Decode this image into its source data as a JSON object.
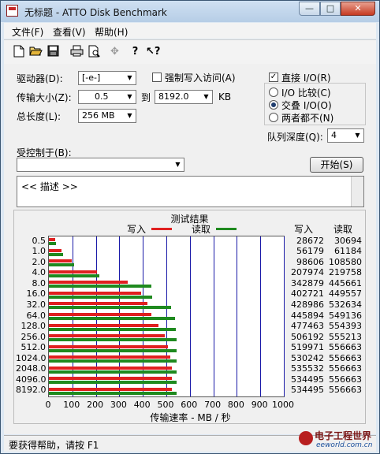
{
  "window": {
    "title": "无标题 - ATTO Disk Benchmark",
    "min": "—",
    "max": "□",
    "close": "✕"
  },
  "menu": [
    "文件(F)",
    "查看(V)",
    "帮助(H)"
  ],
  "toolbar_icons": [
    "new-icon",
    "open-icon",
    "save-icon",
    "print-icon",
    "print-preview-icon",
    "move-icon",
    "help-icon",
    "context-help-icon"
  ],
  "form": {
    "drive_label": "驱动器(D):",
    "drive_value": "[-e-]",
    "force_write_label": "强制写入访问(A)",
    "direct_io_label": "直接 I/O(R)",
    "transfer_label": "传输大小(Z):",
    "transfer_from": "0.5",
    "to_label": "到",
    "transfer_to": "8192.0",
    "kb_label": "KB",
    "io_compare_label": "I/O 比较(C)",
    "overlapped_io_label": "交叠 I/O(O)",
    "neither_label": "两者都不(N)",
    "total_length_label": "总长度(L):",
    "total_length_value": "256 MB",
    "queue_depth_label": "队列深度(Q):",
    "queue_depth_value": "4",
    "controlled_by_label": "受控制于(B):",
    "controlled_by_value": "",
    "start_button": "开始(S)",
    "description": "<< 描述 >>"
  },
  "chart_data": {
    "type": "bar",
    "title": "测试结果",
    "legend": [
      {
        "name": "写入",
        "color": "#e02020"
      },
      {
        "name": "读取",
        "color": "#1f8a1f"
      }
    ],
    "categories": [
      "0.5",
      "1.0",
      "2.0",
      "4.0",
      "8.0",
      "16.0",
      "32.0",
      "64.0",
      "128.0",
      "256.0",
      "512.0",
      "1024.0",
      "2048.0",
      "4096.0",
      "8192.0"
    ],
    "series": [
      {
        "name": "写入",
        "values": [
          28672,
          56179,
          98606,
          207974,
          342879,
          402721,
          428986,
          445894,
          477463,
          506192,
          519971,
          530242,
          535532,
          534495,
          534495
        ]
      },
      {
        "name": "读取",
        "values": [
          30694,
          61184,
          108580,
          219758,
          445661,
          449557,
          532634,
          549136,
          554393,
          555213,
          556663,
          556663,
          556663,
          556663,
          556663
        ]
      }
    ],
    "write_header": "写入",
    "read_header": "读取",
    "write_text": [
      "28672",
      "56179",
      "98606",
      "207974",
      "342879",
      "402721",
      "428986",
      "445894",
      "477463",
      "506192",
      "519971",
      "530242",
      "535532",
      "534495",
      "534495"
    ],
    "read_text": [
      "30694",
      "61184",
      "108580",
      "219758",
      "445661",
      "449557",
      "532634",
      "549136",
      "554393",
      "555213",
      "556663",
      "556663",
      "556663",
      "556663",
      "556663"
    ],
    "xticks": [
      "0",
      "100",
      "200",
      "300",
      "400",
      "500",
      "600",
      "700",
      "800",
      "900",
      "1000"
    ],
    "xlim": [
      0,
      1000
    ],
    "xlabel": "传输速率 - MB / 秒",
    "grid": true
  },
  "status": "要获得帮助，请按 F1",
  "watermark": {
    "line1": "电子工程世界",
    "line2": "eeworld.com.cn"
  }
}
